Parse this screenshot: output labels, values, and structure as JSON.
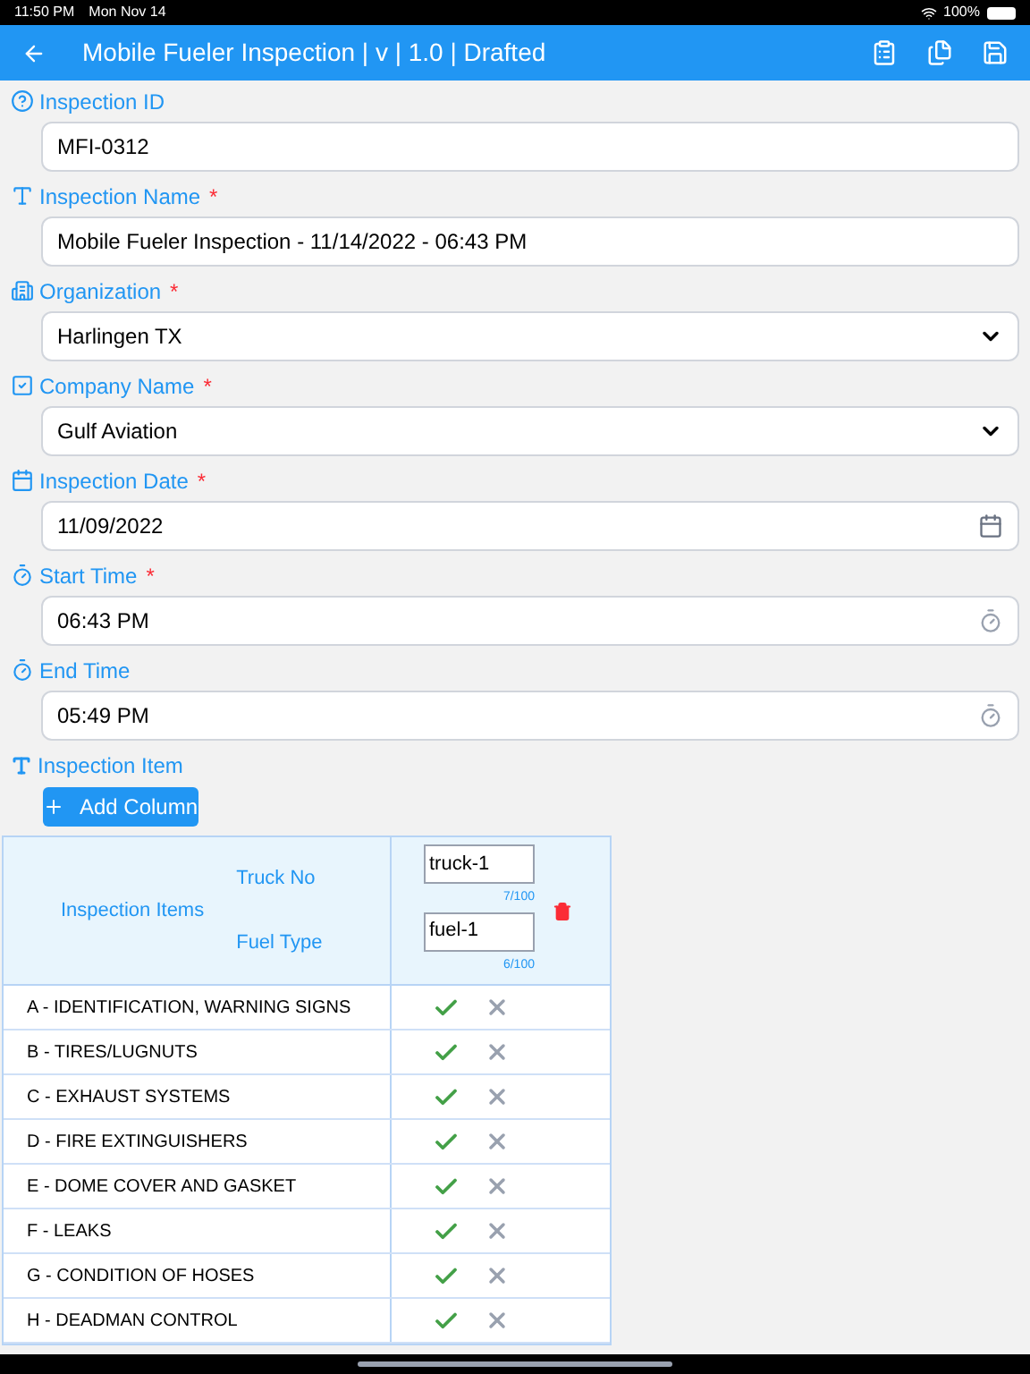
{
  "status_bar": {
    "time": "11:50 PM",
    "date": "Mon Nov 14",
    "battery": "100%"
  },
  "header": {
    "title": "Mobile Fueler Inspection | v | 1.0 | Drafted"
  },
  "fields": [
    {
      "label": "Inspection ID",
      "kind": "text",
      "value": "MFI-0312"
    },
    {
      "label": "Inspection Name",
      "required_mark": "*",
      "kind": "text",
      "value": "Mobile Fueler Inspection - 11/14/2022 - 06:43 PM"
    },
    {
      "label": "Organization",
      "required_mark": "*",
      "kind": "select",
      "value": "Harlingen TX"
    },
    {
      "label": "Company Name",
      "required_mark": "*",
      "kind": "select",
      "value": "Gulf Aviation"
    },
    {
      "label": "Inspection Date",
      "required_mark": "*",
      "kind": "date",
      "value": "11/09/2022"
    },
    {
      "label": "Start Time",
      "required_mark": "*",
      "kind": "time",
      "value": "06:43 PM"
    },
    {
      "label": "End Time",
      "kind": "time",
      "value": "05:49 PM"
    }
  ],
  "inspection_item": {
    "label": "Inspection Item",
    "add_button": "Add Column",
    "table": {
      "items_heading": "Inspection Items",
      "column_labels": [
        "Truck No",
        "Fuel Type"
      ],
      "column_inputs": [
        {
          "value": "truck-1",
          "count": "7/100"
        },
        {
          "value": "fuel-1",
          "count": "6/100"
        }
      ],
      "rows": [
        {
          "item": "A - IDENTIFICATION, WARNING SIGNS",
          "passed": true
        },
        {
          "item": "B - TIRES/LUGNUTS",
          "passed": true
        },
        {
          "item": "C - EXHAUST SYSTEMS",
          "passed": true
        },
        {
          "item": "D - FIRE EXTINGUISHERS",
          "passed": true
        },
        {
          "item": "E - DOME COVER AND GASKET",
          "passed": true
        },
        {
          "item": "F - LEAKS",
          "passed": true
        },
        {
          "item": "G - CONDITION OF HOSES",
          "passed": true
        },
        {
          "item": "H - DEADMAN CONTROL",
          "passed": true
        }
      ]
    }
  }
}
